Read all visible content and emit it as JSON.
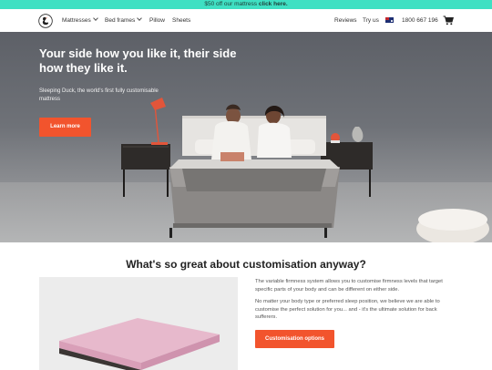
{
  "promo": {
    "text": "$50 off our mattress ",
    "link": "click here."
  },
  "nav": {
    "logo": "sleeping-duck-logo",
    "items": [
      {
        "label": "Mattresses",
        "has_dropdown": true
      },
      {
        "label": "Bed frames",
        "has_dropdown": true
      },
      {
        "label": "Pillow",
        "has_dropdown": false
      },
      {
        "label": "Sheets",
        "has_dropdown": false
      }
    ],
    "right": {
      "reviews": "Reviews",
      "try_us": "Try us",
      "phone": "1800 667 196",
      "flag_icon": "australia-flag-icon",
      "cart_icon": "cart-icon"
    }
  },
  "hero": {
    "title": "Your side how you like it, their side how they like it.",
    "subtitle": "Sleeping Duck, the world's first fully customisable mattress",
    "button": "Learn more"
  },
  "section": {
    "title": "What's so great about customisation anyway?",
    "para1": "The variable firmness system allows you to customise firmness levels that target specific parts of your body and can be different on either side.",
    "para2": "No matter your body type or preferred sleep position, we believe we are able to customise the perfect solution for you... and - it's the ultimate solution for back sufferers.",
    "button": "Customisation options"
  },
  "colors": {
    "accent": "#f2542d",
    "promo_bg": "#3fe0c3"
  }
}
